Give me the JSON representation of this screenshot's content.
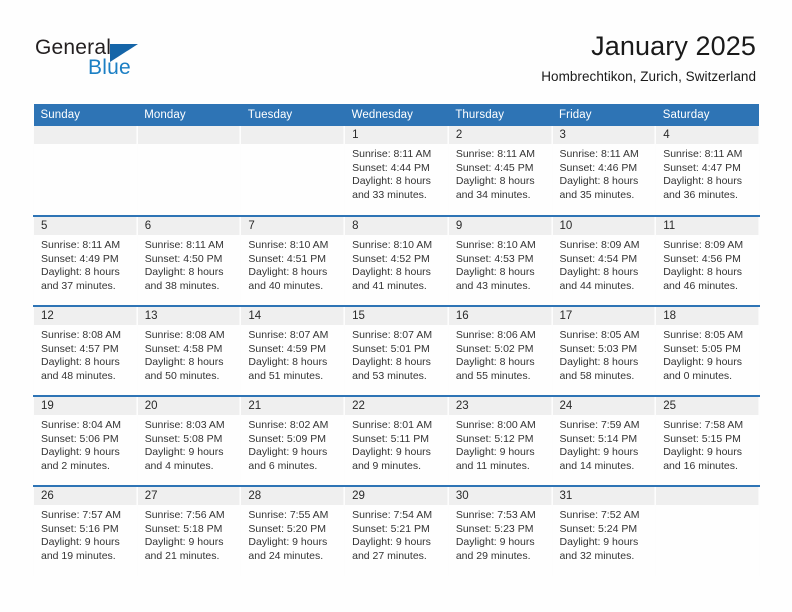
{
  "logo": {
    "word_one": "General",
    "word_two": "Blue",
    "shape": "triangle",
    "color_dark": "#231f20",
    "color_blue": "#1b7fc4",
    "color_triangle": "#1565a8"
  },
  "header": {
    "title": "January 2025",
    "subtitle": "Hombrechtikon, Zurich, Switzerland"
  },
  "theme": {
    "header_blue": "#2e74b5",
    "daynum_band": "#efefef",
    "page_bg": "#fefefe",
    "text": "#343434"
  },
  "weekday_headers": [
    "Sunday",
    "Monday",
    "Tuesday",
    "Wednesday",
    "Thursday",
    "Friday",
    "Saturday"
  ],
  "weeks": [
    [
      {
        "day": "",
        "empty": true,
        "sunrise": "",
        "sunset": "",
        "daylight_1": "",
        "daylight_2": ""
      },
      {
        "day": "",
        "empty": true,
        "sunrise": "",
        "sunset": "",
        "daylight_1": "",
        "daylight_2": ""
      },
      {
        "day": "",
        "empty": true,
        "sunrise": "",
        "sunset": "",
        "daylight_1": "",
        "daylight_2": ""
      },
      {
        "day": "1",
        "empty": false,
        "sunrise": "Sunrise: 8:11 AM",
        "sunset": "Sunset: 4:44 PM",
        "daylight_1": "Daylight: 8 hours",
        "daylight_2": "and 33 minutes."
      },
      {
        "day": "2",
        "empty": false,
        "sunrise": "Sunrise: 8:11 AM",
        "sunset": "Sunset: 4:45 PM",
        "daylight_1": "Daylight: 8 hours",
        "daylight_2": "and 34 minutes."
      },
      {
        "day": "3",
        "empty": false,
        "sunrise": "Sunrise: 8:11 AM",
        "sunset": "Sunset: 4:46 PM",
        "daylight_1": "Daylight: 8 hours",
        "daylight_2": "and 35 minutes."
      },
      {
        "day": "4",
        "empty": false,
        "sunrise": "Sunrise: 8:11 AM",
        "sunset": "Sunset: 4:47 PM",
        "daylight_1": "Daylight: 8 hours",
        "daylight_2": "and 36 minutes."
      }
    ],
    [
      {
        "day": "5",
        "empty": false,
        "sunrise": "Sunrise: 8:11 AM",
        "sunset": "Sunset: 4:49 PM",
        "daylight_1": "Daylight: 8 hours",
        "daylight_2": "and 37 minutes."
      },
      {
        "day": "6",
        "empty": false,
        "sunrise": "Sunrise: 8:11 AM",
        "sunset": "Sunset: 4:50 PM",
        "daylight_1": "Daylight: 8 hours",
        "daylight_2": "and 38 minutes."
      },
      {
        "day": "7",
        "empty": false,
        "sunrise": "Sunrise: 8:10 AM",
        "sunset": "Sunset: 4:51 PM",
        "daylight_1": "Daylight: 8 hours",
        "daylight_2": "and 40 minutes."
      },
      {
        "day": "8",
        "empty": false,
        "sunrise": "Sunrise: 8:10 AM",
        "sunset": "Sunset: 4:52 PM",
        "daylight_1": "Daylight: 8 hours",
        "daylight_2": "and 41 minutes."
      },
      {
        "day": "9",
        "empty": false,
        "sunrise": "Sunrise: 8:10 AM",
        "sunset": "Sunset: 4:53 PM",
        "daylight_1": "Daylight: 8 hours",
        "daylight_2": "and 43 minutes."
      },
      {
        "day": "10",
        "empty": false,
        "sunrise": "Sunrise: 8:09 AM",
        "sunset": "Sunset: 4:54 PM",
        "daylight_1": "Daylight: 8 hours",
        "daylight_2": "and 44 minutes."
      },
      {
        "day": "11",
        "empty": false,
        "sunrise": "Sunrise: 8:09 AM",
        "sunset": "Sunset: 4:56 PM",
        "daylight_1": "Daylight: 8 hours",
        "daylight_2": "and 46 minutes."
      }
    ],
    [
      {
        "day": "12",
        "empty": false,
        "sunrise": "Sunrise: 8:08 AM",
        "sunset": "Sunset: 4:57 PM",
        "daylight_1": "Daylight: 8 hours",
        "daylight_2": "and 48 minutes."
      },
      {
        "day": "13",
        "empty": false,
        "sunrise": "Sunrise: 8:08 AM",
        "sunset": "Sunset: 4:58 PM",
        "daylight_1": "Daylight: 8 hours",
        "daylight_2": "and 50 minutes."
      },
      {
        "day": "14",
        "empty": false,
        "sunrise": "Sunrise: 8:07 AM",
        "sunset": "Sunset: 4:59 PM",
        "daylight_1": "Daylight: 8 hours",
        "daylight_2": "and 51 minutes."
      },
      {
        "day": "15",
        "empty": false,
        "sunrise": "Sunrise: 8:07 AM",
        "sunset": "Sunset: 5:01 PM",
        "daylight_1": "Daylight: 8 hours",
        "daylight_2": "and 53 minutes."
      },
      {
        "day": "16",
        "empty": false,
        "sunrise": "Sunrise: 8:06 AM",
        "sunset": "Sunset: 5:02 PM",
        "daylight_1": "Daylight: 8 hours",
        "daylight_2": "and 55 minutes."
      },
      {
        "day": "17",
        "empty": false,
        "sunrise": "Sunrise: 8:05 AM",
        "sunset": "Sunset: 5:03 PM",
        "daylight_1": "Daylight: 8 hours",
        "daylight_2": "and 58 minutes."
      },
      {
        "day": "18",
        "empty": false,
        "sunrise": "Sunrise: 8:05 AM",
        "sunset": "Sunset: 5:05 PM",
        "daylight_1": "Daylight: 9 hours",
        "daylight_2": "and 0 minutes."
      }
    ],
    [
      {
        "day": "19",
        "empty": false,
        "sunrise": "Sunrise: 8:04 AM",
        "sunset": "Sunset: 5:06 PM",
        "daylight_1": "Daylight: 9 hours",
        "daylight_2": "and 2 minutes."
      },
      {
        "day": "20",
        "empty": false,
        "sunrise": "Sunrise: 8:03 AM",
        "sunset": "Sunset: 5:08 PM",
        "daylight_1": "Daylight: 9 hours",
        "daylight_2": "and 4 minutes."
      },
      {
        "day": "21",
        "empty": false,
        "sunrise": "Sunrise: 8:02 AM",
        "sunset": "Sunset: 5:09 PM",
        "daylight_1": "Daylight: 9 hours",
        "daylight_2": "and 6 minutes."
      },
      {
        "day": "22",
        "empty": false,
        "sunrise": "Sunrise: 8:01 AM",
        "sunset": "Sunset: 5:11 PM",
        "daylight_1": "Daylight: 9 hours",
        "daylight_2": "and 9 minutes."
      },
      {
        "day": "23",
        "empty": false,
        "sunrise": "Sunrise: 8:00 AM",
        "sunset": "Sunset: 5:12 PM",
        "daylight_1": "Daylight: 9 hours",
        "daylight_2": "and 11 minutes."
      },
      {
        "day": "24",
        "empty": false,
        "sunrise": "Sunrise: 7:59 AM",
        "sunset": "Sunset: 5:14 PM",
        "daylight_1": "Daylight: 9 hours",
        "daylight_2": "and 14 minutes."
      },
      {
        "day": "25",
        "empty": false,
        "sunrise": "Sunrise: 7:58 AM",
        "sunset": "Sunset: 5:15 PM",
        "daylight_1": "Daylight: 9 hours",
        "daylight_2": "and 16 minutes."
      }
    ],
    [
      {
        "day": "26",
        "empty": false,
        "sunrise": "Sunrise: 7:57 AM",
        "sunset": "Sunset: 5:16 PM",
        "daylight_1": "Daylight: 9 hours",
        "daylight_2": "and 19 minutes."
      },
      {
        "day": "27",
        "empty": false,
        "sunrise": "Sunrise: 7:56 AM",
        "sunset": "Sunset: 5:18 PM",
        "daylight_1": "Daylight: 9 hours",
        "daylight_2": "and 21 minutes."
      },
      {
        "day": "28",
        "empty": false,
        "sunrise": "Sunrise: 7:55 AM",
        "sunset": "Sunset: 5:20 PM",
        "daylight_1": "Daylight: 9 hours",
        "daylight_2": "and 24 minutes."
      },
      {
        "day": "29",
        "empty": false,
        "sunrise": "Sunrise: 7:54 AM",
        "sunset": "Sunset: 5:21 PM",
        "daylight_1": "Daylight: 9 hours",
        "daylight_2": "and 27 minutes."
      },
      {
        "day": "30",
        "empty": false,
        "sunrise": "Sunrise: 7:53 AM",
        "sunset": "Sunset: 5:23 PM",
        "daylight_1": "Daylight: 9 hours",
        "daylight_2": "and 29 minutes."
      },
      {
        "day": "31",
        "empty": false,
        "sunrise": "Sunrise: 7:52 AM",
        "sunset": "Sunset: 5:24 PM",
        "daylight_1": "Daylight: 9 hours",
        "daylight_2": "and 32 minutes."
      },
      {
        "day": "",
        "empty": true,
        "sunrise": "",
        "sunset": "",
        "daylight_1": "",
        "daylight_2": ""
      }
    ]
  ]
}
